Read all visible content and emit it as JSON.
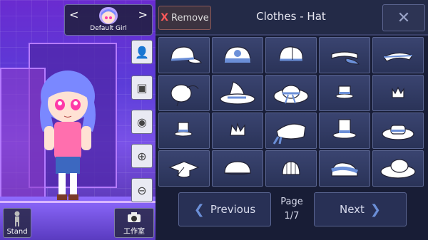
{
  "character": {
    "name": "Default Girl"
  },
  "panel": {
    "remove_label": "Remove",
    "title": "Clothes - Hat",
    "close_glyph": "✕"
  },
  "hats": [
    {
      "name": "cap"
    },
    {
      "name": "logo-cap"
    },
    {
      "name": "cap-2"
    },
    {
      "name": "visor"
    },
    {
      "name": "visor-2"
    },
    {
      "name": "beret-feather"
    },
    {
      "name": "witch-hat"
    },
    {
      "name": "sun-hat-bow"
    },
    {
      "name": "mini-top-hat"
    },
    {
      "name": "mini-crown"
    },
    {
      "name": "tiny-top-hat"
    },
    {
      "name": "tiara"
    },
    {
      "name": "bandana"
    },
    {
      "name": "top-hat"
    },
    {
      "name": "boater"
    },
    {
      "name": "grad-cap"
    },
    {
      "name": "beanie"
    },
    {
      "name": "knit-cap"
    },
    {
      "name": "headband"
    },
    {
      "name": "wide-brim-hat"
    }
  ],
  "pagination": {
    "previous_label": "Previous",
    "next_label": "Next",
    "page_label": "Page",
    "page_value": "1/7"
  },
  "bottom": {
    "stand_label": "Stand",
    "studio_label": "工作室"
  },
  "colors": {
    "accent": "#5a8fe0",
    "panel_bg": "#181d36",
    "remove_x": "#ff5a5a"
  }
}
